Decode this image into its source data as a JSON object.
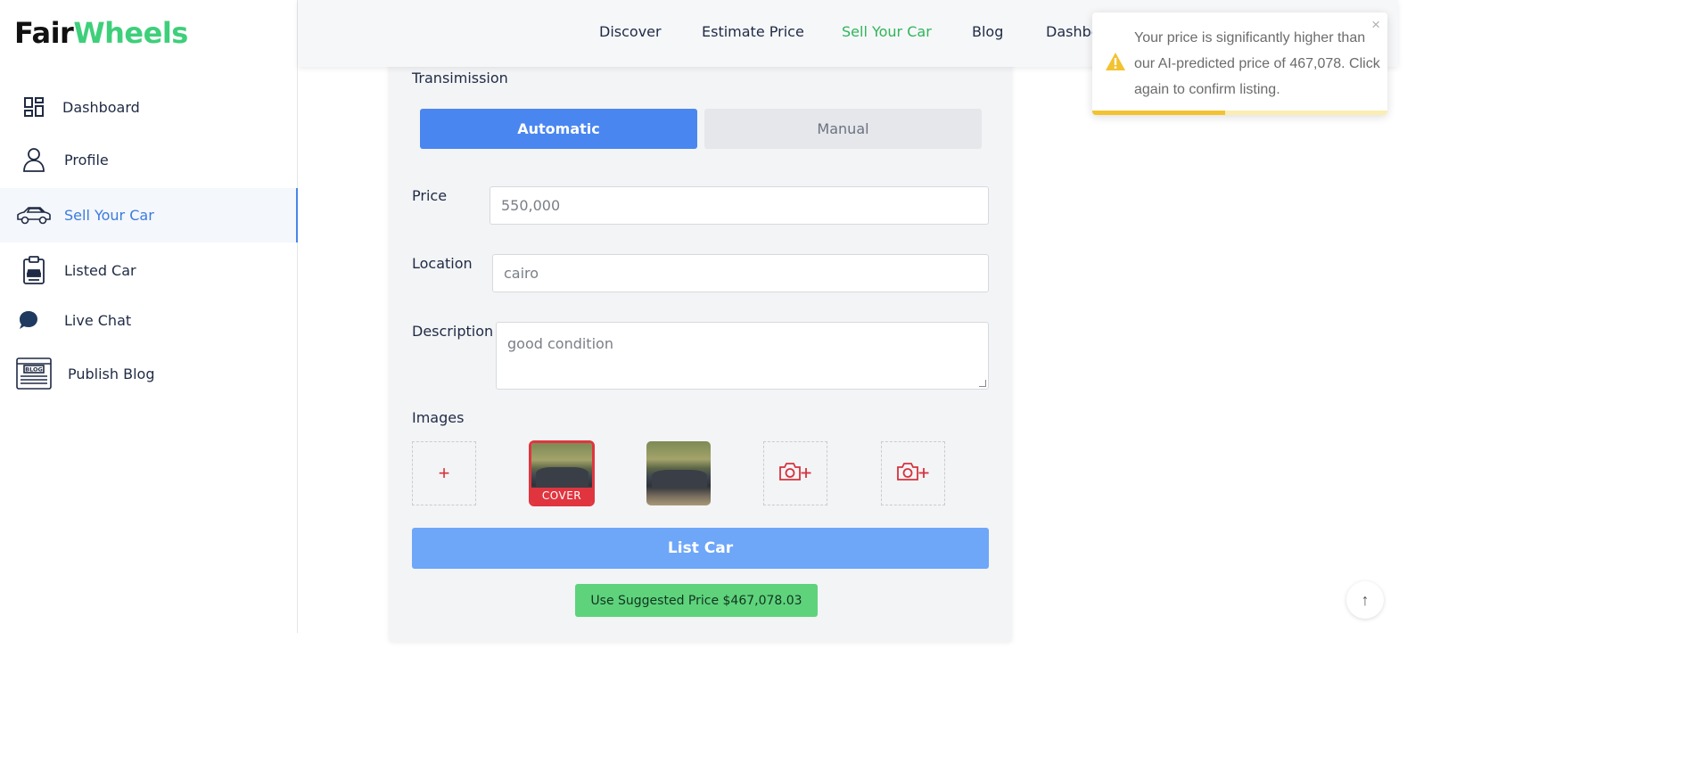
{
  "brand": {
    "part1": "Fair",
    "part2": "Wheels"
  },
  "sidebar": {
    "items": [
      {
        "label": "Dashboard",
        "icon": "dashboard-icon"
      },
      {
        "label": "Profile",
        "icon": "user-icon"
      },
      {
        "label": "Sell Your Car",
        "icon": "car-icon",
        "active": true
      },
      {
        "label": "Listed Car",
        "icon": "clipboard-car-icon"
      },
      {
        "label": "Live Chat",
        "icon": "chat-bubble-icon"
      },
      {
        "label": "Publish Blog",
        "icon": "blog-window-icon"
      }
    ]
  },
  "topnav": {
    "items": [
      {
        "label": "Discover"
      },
      {
        "label": "Estimate Price"
      },
      {
        "label": "Sell Your Car",
        "active": true
      },
      {
        "label": "Blog"
      },
      {
        "label": "Dashboard"
      }
    ]
  },
  "form": {
    "transmission_label": "Transimission",
    "transmission_options": [
      "Automatic",
      "Manual"
    ],
    "transmission_selected": "Automatic",
    "price_label": "Price",
    "price_value": "550,000",
    "location_label": "Location",
    "location_value": "cairo",
    "description_label": "Description",
    "description_value": "good condition",
    "images_label": "Images",
    "add_image_symbol": "+",
    "cover_label": "COVER",
    "list_button": "List Car",
    "suggest_button": "Use Suggested Price $467,078.03"
  },
  "toast": {
    "message": "Your price is significantly higher than our AI-predicted price of 467,078. Click again to confirm listing.",
    "close_symbol": "×",
    "icon": "warning-icon",
    "progress": 0.45
  },
  "scroll_top_symbol": "↑",
  "colors": {
    "brand_green": "#3ecf7a",
    "active_blue": "#4a86f0",
    "cover_red": "#e0353f",
    "suggest_green": "#5ed37c",
    "warning_yellow": "#f2c230"
  }
}
